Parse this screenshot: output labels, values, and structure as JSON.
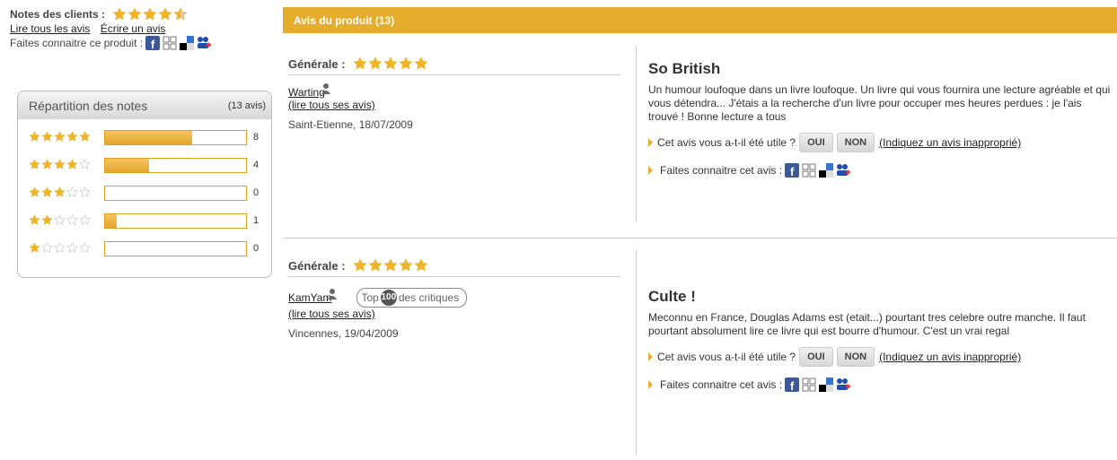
{
  "left": {
    "notes_label": "Notes des clients :",
    "notes_rating": 4.5,
    "read_all": "Lire tous les avis",
    "write": "Écrire un avis",
    "share_label": "Faites connaitre ce produit :"
  },
  "repartition": {
    "title": "Répartition des notes",
    "count": "(13 avis)",
    "rows": [
      {
        "stars": 5,
        "count": "8",
        "fraction": 0.62
      },
      {
        "stars": 4,
        "count": "4",
        "fraction": 0.31
      },
      {
        "stars": 3,
        "count": "0",
        "fraction": 0
      },
      {
        "stars": 2,
        "count": "1",
        "fraction": 0.08
      },
      {
        "stars": 1,
        "count": "0",
        "fraction": 0
      }
    ]
  },
  "banner": {
    "title": "Avis du produit (13)"
  },
  "reviews": [
    {
      "general_label": "Générale :",
      "rating": 5,
      "author": "Warting",
      "read_all": "(lire tous ses avis)",
      "place": "Saint-Etienne, 18/07/2009",
      "title": "So British",
      "body": "Un humour loufoque dans un livre loufoque. Un livre qui vous fournira une lecture agréable et qui vous détendra... J'étais a la recherche d'un livre pour occuper mes heures perdues : je l'ais trouvé ! Bonne lecture a tous",
      "useful_q": "Cet avis vous a-t-il été utile ?",
      "yes": "OUI",
      "no": "NON",
      "report": "(Indiquez un avis inapproprié)",
      "share": "Faites connaitre cet avis :"
    },
    {
      "general_label": "Générale :",
      "rating": 5,
      "author": "KamYam",
      "top_prefix": "Top",
      "top_num": "100",
      "top_suffix": "des critiques",
      "read_all": "(lire tous ses avis)",
      "place": "Vincennes, 19/04/2009",
      "title": "Culte !",
      "body": "Meconnu en France, Douglas Adams est (etait...) pourtant tres celebre outre manche. Il faut pourtant absolument lire ce livre qui est bourre d'humour. C'est un vrai regal",
      "useful_q": "Cet avis vous a-t-il été utile ?",
      "yes": "OUI",
      "no": "NON",
      "report": "(Indiquez un avis inapproprié)",
      "share": "Faites connaitre cet avis :"
    }
  ],
  "colors": {
    "accent": "#e6ad2c",
    "star": "#f0b429",
    "star_empty": "#cccccc"
  },
  "icons": [
    "facebook-icon",
    "share-icon",
    "delicious-icon",
    "myspace-icon",
    "person-icon",
    "star-icon"
  ]
}
